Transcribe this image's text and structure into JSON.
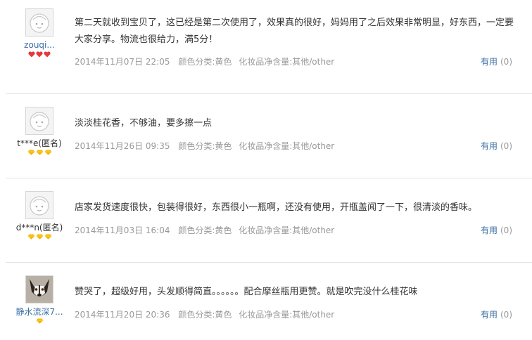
{
  "reviews": [
    {
      "username": "zouqi...",
      "level_icon": "red-heart",
      "level_count": 3,
      "content": "第二天就收到宝贝了，这已经是第二次使用了，效果真的很好，妈妈用了之后效果非常明显，好东西，一定要大家分享。物流也很给力，满5分！",
      "date": "2014年11月07日 22:05",
      "color": "颜色分类:黄色",
      "size": "化妆品净含量:其他/other",
      "useful_label": "有用",
      "useful_count": "(0)"
    },
    {
      "username": "t***e(匿名)",
      "level_icon": "yellow-diamond",
      "level_count": 3,
      "content": "淡淡桂花香，不够油，要多擦一点",
      "date": "2014年11月26日 09:35",
      "color": "颜色分类:黄色",
      "size": "化妆品净含量:其他/other",
      "useful_label": "有用",
      "useful_count": "(0)"
    },
    {
      "username": "d***n(匿名)",
      "level_icon": "yellow-diamond",
      "level_count": 3,
      "content": "店家发货速度很快，包装得很好，东西很小一瓶啊，还没有使用，开瓶盖闻了一下，很清淡的香味。",
      "date": "2014年11月03日 16:04",
      "color": "颜色分类:黄色",
      "size": "化妆品净含量:其他/other",
      "useful_label": "有用",
      "useful_count": "(0)"
    },
    {
      "username": "静水流深7...",
      "level_icon": "yellow-diamond",
      "level_count": 1,
      "content": "赞哭了，超级好用，头发顺得简直。。。。。。配合摩丝瓶用更赞。就是吹完没什么桂花味",
      "date": "2014年11月20日 20:36",
      "color": "颜色分类:黄色",
      "size": "化妆品净含量:其他/other",
      "useful_label": "有用",
      "useful_count": "(0)"
    }
  ],
  "colors": {
    "link": "#3a6ea5",
    "meta": "#999999",
    "heart": "#e4393c",
    "diamond": "#f5b800"
  }
}
